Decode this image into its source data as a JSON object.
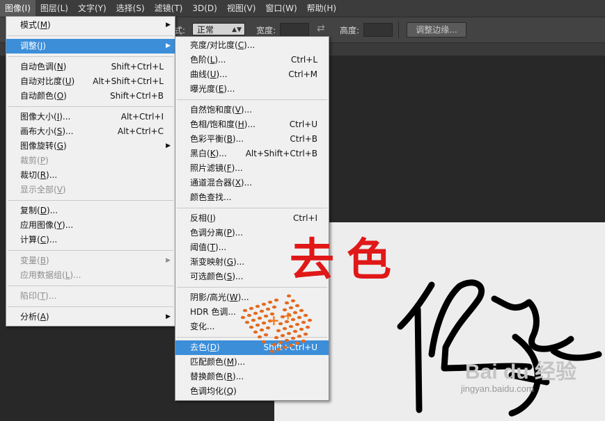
{
  "menubar": {
    "items": [
      "图像(I)",
      "图层(L)",
      "文字(Y)",
      "选择(S)",
      "滤镜(T)",
      "3D(D)",
      "视图(V)",
      "窗口(W)",
      "帮助(H)"
    ],
    "active": "图像(I)"
  },
  "options": {
    "style_label": "式:",
    "style_value": "正常",
    "width_label": "宽度:",
    "height_label": "高度:",
    "refine_button": "调整边缘..."
  },
  "image_menu": {
    "items": [
      {
        "pre": "模式(",
        "key": "M",
        "post": ")",
        "shortcut": "",
        "submenu": true
      },
      {
        "divider": true
      },
      {
        "pre": "调整(",
        "key": "J",
        "post": ")",
        "shortcut": "",
        "submenu": true,
        "highlight": true
      },
      {
        "divider": true
      },
      {
        "pre": "自动色调(",
        "key": "N",
        "post": ")",
        "shortcut": "Shift+Ctrl+L"
      },
      {
        "pre": "自动对比度(",
        "key": "U",
        "post": ")",
        "shortcut": "Alt+Shift+Ctrl+L"
      },
      {
        "pre": "自动颜色(",
        "key": "O",
        "post": ")",
        "shortcut": "Shift+Ctrl+B"
      },
      {
        "divider": true
      },
      {
        "pre": "图像大小(",
        "key": "I",
        "post": ")...",
        "shortcut": "Alt+Ctrl+I"
      },
      {
        "pre": "画布大小(",
        "key": "S",
        "post": ")...",
        "shortcut": "Alt+Ctrl+C"
      },
      {
        "pre": "图像旋转(",
        "key": "G",
        "post": ")",
        "shortcut": "",
        "submenu": true
      },
      {
        "pre": "裁剪(",
        "key": "P",
        "post": ")",
        "shortcut": "",
        "disabled": true
      },
      {
        "pre": "裁切(",
        "key": "R",
        "post": ")...",
        "shortcut": ""
      },
      {
        "pre": "显示全部(",
        "key": "V",
        "post": ")",
        "shortcut": "",
        "disabled": true
      },
      {
        "divider": true
      },
      {
        "pre": "复制(",
        "key": "D",
        "post": ")...",
        "shortcut": ""
      },
      {
        "pre": "应用图像(",
        "key": "Y",
        "post": ")...",
        "shortcut": ""
      },
      {
        "pre": "计算(",
        "key": "C",
        "post": ")...",
        "shortcut": ""
      },
      {
        "divider": true
      },
      {
        "pre": "变量(",
        "key": "B",
        "post": ")",
        "shortcut": "",
        "submenu": true,
        "disabled": true
      },
      {
        "pre": "应用数据组(",
        "key": "L",
        "post": ")...",
        "shortcut": "",
        "disabled": true
      },
      {
        "divider": true
      },
      {
        "pre": "陷印(",
        "key": "T",
        "post": ")...",
        "shortcut": "",
        "disabled": true
      },
      {
        "divider": true
      },
      {
        "pre": "分析(",
        "key": "A",
        "post": ")",
        "shortcut": "",
        "submenu": true
      }
    ]
  },
  "adjust_menu": {
    "items": [
      {
        "pre": "亮度/对比度(",
        "key": "C",
        "post": ")...",
        "shortcut": ""
      },
      {
        "pre": "色阶(",
        "key": "L",
        "post": ")...",
        "shortcut": "Ctrl+L"
      },
      {
        "pre": "曲线(",
        "key": "U",
        "post": ")...",
        "shortcut": "Ctrl+M"
      },
      {
        "pre": "曝光度(",
        "key": "E",
        "post": ")...",
        "shortcut": ""
      },
      {
        "divider": true
      },
      {
        "pre": "自然饱和度(",
        "key": "V",
        "post": ")...",
        "shortcut": ""
      },
      {
        "pre": "色相/饱和度(",
        "key": "H",
        "post": ")...",
        "shortcut": "Ctrl+U"
      },
      {
        "pre": "色彩平衡(",
        "key": "B",
        "post": ")...",
        "shortcut": "Ctrl+B"
      },
      {
        "pre": "黑白(",
        "key": "K",
        "post": ")...",
        "shortcut": "Alt+Shift+Ctrl+B"
      },
      {
        "pre": "照片滤镜(",
        "key": "F",
        "post": ")...",
        "shortcut": ""
      },
      {
        "pre": "通道混合器(",
        "key": "X",
        "post": ")...",
        "shortcut": ""
      },
      {
        "pre": "颜色查找...",
        "key": "",
        "post": "",
        "shortcut": ""
      },
      {
        "divider": true
      },
      {
        "pre": "反相(",
        "key": "I",
        "post": ")",
        "shortcut": "Ctrl+I"
      },
      {
        "pre": "色调分离(",
        "key": "P",
        "post": ")...",
        "shortcut": ""
      },
      {
        "pre": "阈值(",
        "key": "T",
        "post": ")...",
        "shortcut": ""
      },
      {
        "pre": "渐变映射(",
        "key": "G",
        "post": ")...",
        "shortcut": ""
      },
      {
        "pre": "可选颜色(",
        "key": "S",
        "post": ")...",
        "shortcut": ""
      },
      {
        "divider": true
      },
      {
        "pre": "阴影/高光(",
        "key": "W",
        "post": ")...",
        "shortcut": ""
      },
      {
        "pre": "HDR 色调...",
        "key": "",
        "post": "",
        "shortcut": ""
      },
      {
        "pre": "变化...",
        "key": "",
        "post": "",
        "shortcut": ""
      },
      {
        "divider": true
      },
      {
        "pre": "去色(",
        "key": "D",
        "post": ")",
        "shortcut": "Shift+Ctrl+U",
        "highlight": true
      },
      {
        "pre": "匹配颜色(",
        "key": "M",
        "post": ")...",
        "shortcut": ""
      },
      {
        "pre": "替换颜色(",
        "key": "R",
        "post": ")...",
        "shortcut": ""
      },
      {
        "pre": "色调均化(",
        "key": "Q",
        "post": ")",
        "shortcut": ""
      }
    ]
  },
  "annotation": "去色",
  "watermark": {
    "logo": "Bai du 经验",
    "url": "jingyan.baidu.com"
  },
  "colors": {
    "highlight": "#3c8ed9",
    "annotation": "#e01818",
    "menu_bg": "#f0f0f0"
  }
}
